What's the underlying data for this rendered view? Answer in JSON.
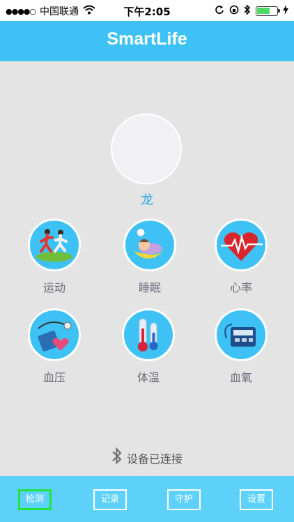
{
  "status_bar": {
    "signal": "●●●●○",
    "carrier": "中国联通",
    "time": "下午2:05",
    "battery_level": 0.65
  },
  "header": {
    "title": "SmartLife"
  },
  "profile": {
    "name": "龙"
  },
  "features": [
    {
      "label": "运动",
      "icon": "running-icon"
    },
    {
      "label": "睡眠",
      "icon": "sleep-icon"
    },
    {
      "label": "心率",
      "icon": "heart-rate-icon"
    },
    {
      "label": "血压",
      "icon": "blood-pressure-icon"
    },
    {
      "label": "体温",
      "icon": "thermometer-icon"
    },
    {
      "label": "血氧",
      "icon": "blood-oxygen-icon"
    }
  ],
  "device_status": {
    "text": "设备已连接",
    "icon": "bluetooth-icon"
  },
  "tabs": [
    {
      "label": "检测",
      "active": true
    },
    {
      "label": "记录",
      "active": false
    },
    {
      "label": "守护",
      "active": false
    },
    {
      "label": "设置",
      "active": false
    }
  ],
  "colors": {
    "primary": "#3ec2f6",
    "tabbar": "#5ed1fa",
    "active_tab_border": "#22e33b",
    "background": "#e4e4e4"
  }
}
